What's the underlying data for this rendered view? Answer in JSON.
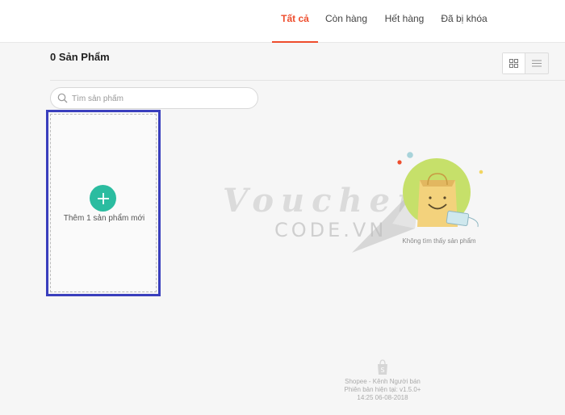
{
  "tabs": [
    {
      "label": "Tất cả",
      "active": true
    },
    {
      "label": "Còn hàng",
      "active": false
    },
    {
      "label": "Hết hàng",
      "active": false
    },
    {
      "label": "Đã bị khóa",
      "active": false
    }
  ],
  "product_count_label": "0 Sản Phẩm",
  "view_toggle": {
    "options": [
      "grid-icon",
      "list-icon"
    ],
    "selected": "grid-icon"
  },
  "search": {
    "placeholder": "Tìm sản phẩm",
    "value": ""
  },
  "add_card": {
    "label": "Thêm 1 sản phẩm mới",
    "icon": "plus-icon"
  },
  "empty_state": {
    "message": "Không tìm thấy sản phẩm",
    "icon": "empty-shopping-bag-icon"
  },
  "watermark": {
    "line1": "Voucher",
    "line2": "CODE.VN"
  },
  "footer": {
    "brand": "Shopee - Kênh Người bán",
    "version": "Phiên bản hiện tại: v1.5.0+",
    "timestamp": "14:25 06-08-2018"
  },
  "colors": {
    "accent": "#ee4d2d",
    "add_button": "#2bbca0",
    "highlight_box": "#3a3fbd",
    "empty_circle": "#c6e06a"
  }
}
